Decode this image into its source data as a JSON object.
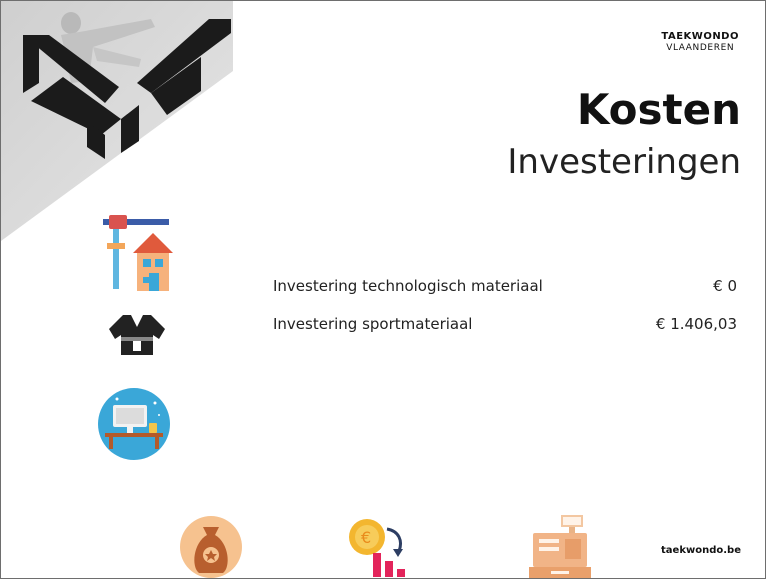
{
  "header": {
    "org_line1": "TAEKWONDO",
    "org_line2": "VLAANDEREN"
  },
  "slide": {
    "title": "Kosten",
    "subtitle": "Investeringen"
  },
  "costs": [
    {
      "label": "Investering technologisch materiaal",
      "value": "€ 0"
    },
    {
      "label": "Investering sportmateriaal",
      "value": "€ 1.406,03"
    }
  ],
  "icons": {
    "side": [
      "construction-house-icon",
      "dobok-uniform-icon",
      "computer-desk-icon"
    ],
    "bottom": [
      "money-bag-icon",
      "coin-decline-icon",
      "cash-register-icon"
    ]
  },
  "colors": {
    "accent_orange": "#f5a15a",
    "accent_blue": "#3aa7d8",
    "brand_dark": "#1b1b1b",
    "panel_gray": "#d7d7d7"
  },
  "footer": {
    "website": "taekwondo.be"
  }
}
